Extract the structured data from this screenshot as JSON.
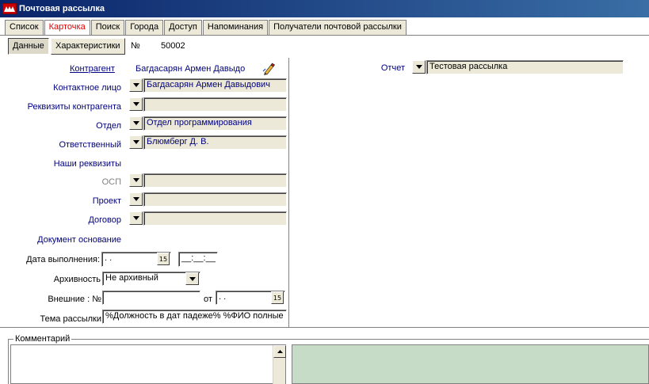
{
  "window": {
    "title": "Почтовая рассылка"
  },
  "tabs": [
    "Список",
    "Карточка",
    "Поиск",
    "Города",
    "Доступ",
    "Напоминания",
    "Получатели почтовой рассылки"
  ],
  "subtabs": {
    "data": "Данные",
    "characteristics": "Характеристики"
  },
  "record": {
    "number_label": "№",
    "number_value": "50002"
  },
  "form": {
    "kontragent": {
      "label": "Контрагент",
      "value": "Багдасарян Армен Давыдо"
    },
    "contact": {
      "label": "Контактное лицо",
      "value": "Багдасарян Армен Давыдович"
    },
    "requisites": {
      "label": "Реквизиты контрагента",
      "value": ""
    },
    "department": {
      "label": "Отдел",
      "value": "Отдел программирования"
    },
    "responsible": {
      "label": "Ответственный",
      "value": "Блюмберг Д. В."
    },
    "our_requisites": {
      "label": "Наши реквизиты"
    },
    "osp": {
      "label": "ОСП",
      "value": ""
    },
    "project": {
      "label": "Проект",
      "value": ""
    },
    "contract": {
      "label": "Договор",
      "value": ""
    },
    "base_doc": {
      "label": "Документ основание"
    },
    "exec_date": {
      "label": "Дата выполнения:",
      "date": " . .",
      "time": "__:__:__"
    },
    "archive": {
      "label": "Архивность",
      "value": "Не архивный"
    },
    "external": {
      "label": "Внешние : №",
      "value": "",
      "from_label": "от",
      "date": " . ."
    },
    "topic": {
      "label": "Тема рассылки",
      "value": "%Должность в дат падеже% %ФИО полные"
    },
    "report": {
      "label": "Отчет",
      "value": "Тестовая рассылка"
    }
  },
  "comment": {
    "label": "Комментарий",
    "value": ""
  },
  "icons": {
    "dropdown": "chevron-down-icon",
    "calendar": "calendar-icon",
    "edit": "pencil-edit-icon"
  }
}
